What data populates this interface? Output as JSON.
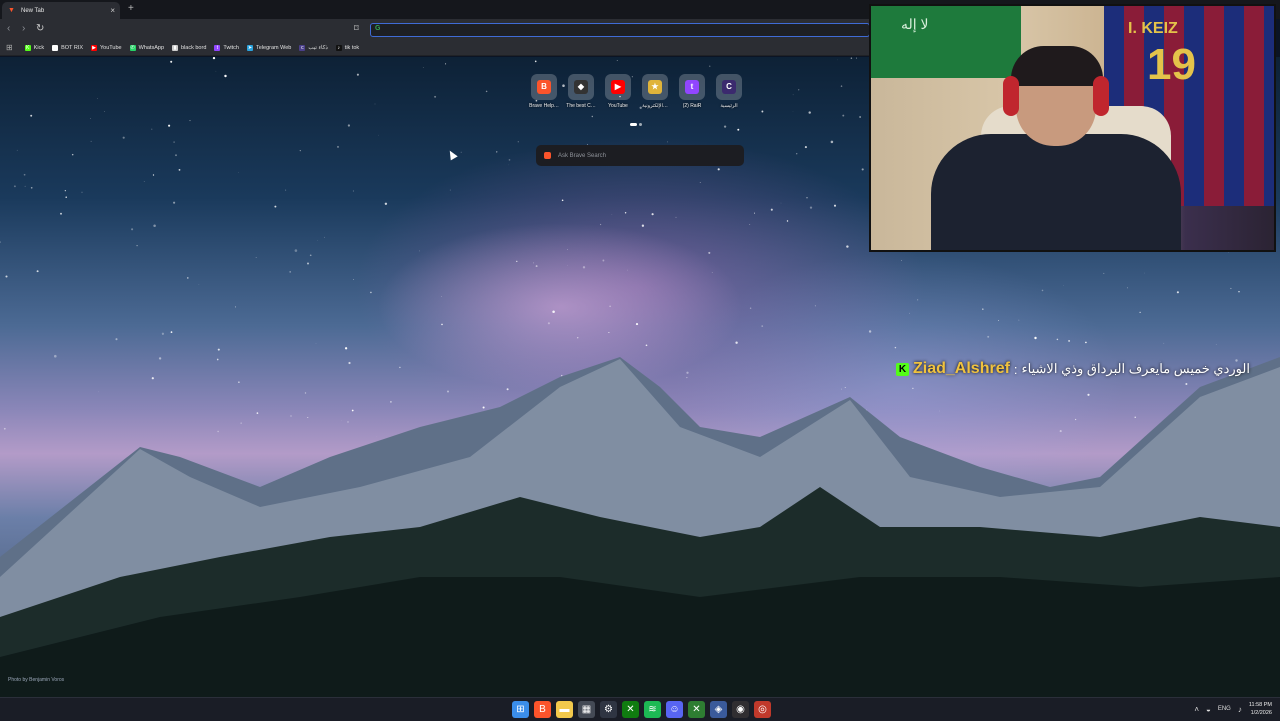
{
  "browser": {
    "tab_title": "New Tab",
    "tab_close": "×",
    "new_tab": "+",
    "back": "‹",
    "forward": "›",
    "reload": "↻",
    "bookmark_icon": "bookmark-icon",
    "omnibox_value": "",
    "omnibox_engine_icon": "G"
  },
  "bookmarks": [
    {
      "label": "Kick",
      "icon": "K",
      "color": "#53fc18"
    },
    {
      "label": "BOT RIX",
      "icon": "◆",
      "color": "#ffffff"
    },
    {
      "label": "YouTube",
      "icon": "▶",
      "color": "#ff0000"
    },
    {
      "label": "WhatsApp",
      "icon": "✆",
      "color": "#25d366"
    },
    {
      "label": "black bord",
      "icon": "▮",
      "color": "#cccccc"
    },
    {
      "label": "Twitch",
      "icon": "t",
      "color": "#9146ff"
    },
    {
      "label": "Telegram Web",
      "icon": "➤",
      "color": "#2aa3de"
    },
    {
      "label": "ذكاء تيب",
      "icon": "c",
      "color": "#4a3f8a"
    },
    {
      "label": "tik tok",
      "icon": "♪",
      "color": "#111111"
    }
  ],
  "top_sites": [
    {
      "label": "Brave Help…",
      "icon": "B",
      "color": "#fb542b"
    },
    {
      "label": "The best C…",
      "icon": "◆",
      "color": "#333333"
    },
    {
      "label": "YouTube",
      "icon": "▶",
      "color": "#ff0000"
    },
    {
      "label": "الإلكترونية…",
      "icon": "★",
      "color": "#e0b43a"
    },
    {
      "label": "(2) RaiR",
      "icon": "t",
      "color": "#9146ff"
    },
    {
      "label": "الرئيسية",
      "icon": "C",
      "color": "#3b2a6e"
    }
  ],
  "search": {
    "placeholder": "Ask Brave Search"
  },
  "wallpaper_credit": "Photo by Benjamin Voros",
  "webcam": {
    "jersey_name": "I. KEIZ",
    "jersey_number": "19",
    "flag_text": "لا إله"
  },
  "chat": {
    "platform_badge": "K",
    "username": "Ziad_Alshref",
    "separator": ":",
    "message": "الوردي خميس مايعرف البرداق وذي الاشياء"
  },
  "taskbar": {
    "apps": [
      {
        "name": "start",
        "icon": "⊞",
        "color": "#3b8eea"
      },
      {
        "name": "brave",
        "icon": "B",
        "color": "#fb542b"
      },
      {
        "name": "explorer",
        "icon": "▬",
        "color": "#f2c94c"
      },
      {
        "name": "calculator",
        "icon": "▦",
        "color": "#444a55"
      },
      {
        "name": "settings",
        "icon": "⚙",
        "color": "#2f3542"
      },
      {
        "name": "xbox",
        "icon": "✕",
        "color": "#107c10"
      },
      {
        "name": "spotify",
        "icon": "≋",
        "color": "#1db954"
      },
      {
        "name": "discord",
        "icon": "☺",
        "color": "#5865f2"
      },
      {
        "name": "xbox-app",
        "icon": "✕",
        "color": "#2e7d32"
      },
      {
        "name": "shield",
        "icon": "◈",
        "color": "#3a5a9a"
      },
      {
        "name": "obs",
        "icon": "◉",
        "color": "#302e31"
      },
      {
        "name": "app",
        "icon": "◎",
        "color": "#c0392b"
      }
    ],
    "language": "ENG",
    "time": "11:58 PM",
    "date": "1/2/2026",
    "tray_chevron": "˄",
    "tray_wifi": "◒",
    "tray_volume": "♪"
  }
}
